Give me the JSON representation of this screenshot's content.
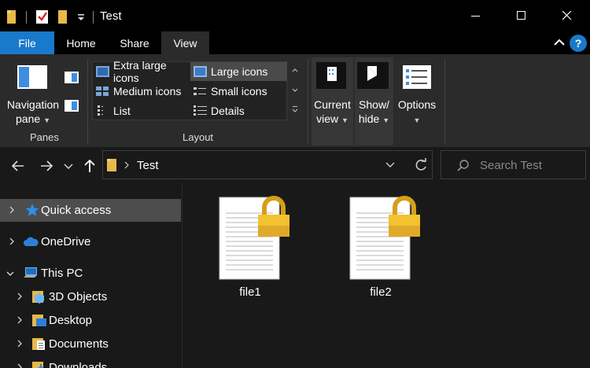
{
  "titlebar": {
    "title": "Test",
    "minimize_icon": "minimize-icon",
    "maximize_icon": "maximize-icon",
    "close_icon": "close-icon"
  },
  "tabs": [
    {
      "label": "File"
    },
    {
      "label": "Home"
    },
    {
      "label": "Share"
    },
    {
      "label": "View"
    }
  ],
  "ribbon": {
    "panes": {
      "navigation_pane_label": "Navigation pane",
      "group_label": "Panes"
    },
    "layout": {
      "group_label": "Layout",
      "items": [
        {
          "label": "Extra large icons",
          "selected": false
        },
        {
          "label": "Large icons",
          "selected": true
        },
        {
          "label": "Medium icons",
          "selected": false
        },
        {
          "label": "Small icons",
          "selected": false
        },
        {
          "label": "List",
          "selected": false
        },
        {
          "label": "Details",
          "selected": false
        }
      ]
    },
    "current_view_label": "Current view",
    "show_hide_label": "Show/ hide",
    "options_label": "Options"
  },
  "address": {
    "path": "Test",
    "search_placeholder": "Search Test"
  },
  "navpane": {
    "items": [
      {
        "label": "Quick access",
        "icon": "star-icon",
        "selected": true
      },
      {
        "label": "OneDrive",
        "icon": "cloud-icon"
      },
      {
        "label": "This PC",
        "icon": "computer-icon",
        "expanded": true
      },
      {
        "label": "3D Objects",
        "icon": "3d-objects-icon"
      },
      {
        "label": "Desktop",
        "icon": "desktop-folder-icon"
      },
      {
        "label": "Documents",
        "icon": "documents-folder-icon"
      },
      {
        "label": "Downloads",
        "icon": "downloads-folder-icon"
      }
    ]
  },
  "files": [
    {
      "name": "file1",
      "icon": "locked-document-icon"
    },
    {
      "name": "file2",
      "icon": "locked-document-icon"
    }
  ],
  "colors": {
    "accent": "#1979ca",
    "background": "#191919",
    "ribbon": "#2b2b2b",
    "lock_gold": "#f2c230"
  }
}
